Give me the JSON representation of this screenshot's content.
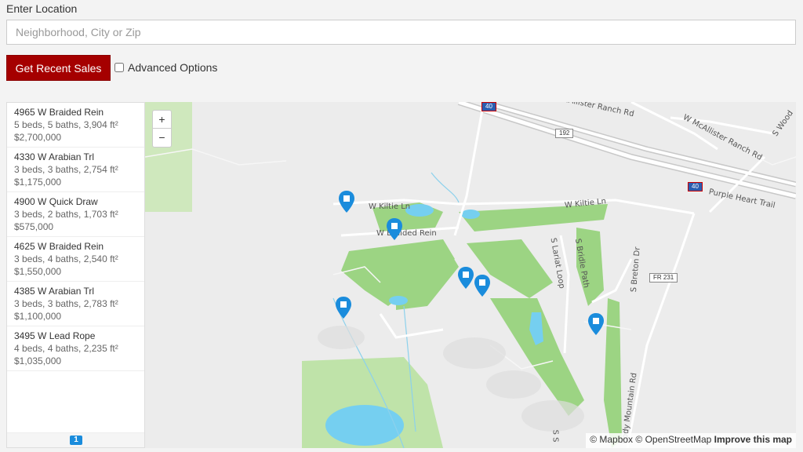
{
  "search": {
    "label": "Enter Location",
    "placeholder": "Neighborhood, City or Zip",
    "button_label": "Get Recent Sales",
    "advanced_label": "Advanced Options"
  },
  "listings": [
    {
      "address": "4965 W Braided Rein",
      "details": "5 beds, 5 baths, 3,904 ft²",
      "price": "$2,700,000"
    },
    {
      "address": "4330 W Arabian Trl",
      "details": "3 beds, 3 baths, 2,754 ft²",
      "price": "$1,175,000"
    },
    {
      "address": "4900 W Quick Draw",
      "details": "3 beds, 2 baths, 1,703 ft²",
      "price": "$575,000"
    },
    {
      "address": "4625 W Braided Rein",
      "details": "3 beds, 4 baths, 2,540 ft²",
      "price": "$1,550,000"
    },
    {
      "address": "4385 W Arabian Trl",
      "details": "3 beds, 3 baths, 2,783 ft²",
      "price": "$1,100,000"
    },
    {
      "address": "3495 W Lead Rope",
      "details": "4 beds, 4 baths, 2,235 ft²",
      "price": "$1,035,000"
    }
  ],
  "pagination": {
    "current_page": "1"
  },
  "map": {
    "zoom_in": "+",
    "zoom_out": "−",
    "labels": {
      "mcallister_ranch": "McAllister Ranch Rd",
      "w_mcallister_ranch": "W McAllister Ranch Rd",
      "s_wood": "S Wood",
      "w_kiltie_ln_1": "W Kiltie Ln",
      "w_kiltie_ln_2": "W Kiltie Ln",
      "w_braided_rein": "W Braided Rein",
      "purple_heart_trail": "Purple Heart Trail",
      "s_lariat_loop": "S Lariat Loop",
      "s_bridle_path": "S Bridle Path",
      "s_breton_dr": "S Breton Dr",
      "body_mountain_rd": "Body Mountain Rd",
      "s_s": "S S"
    },
    "shields": {
      "fr_192": "192",
      "fr_231": "FR 231",
      "i40": "40",
      "i40_top": "40"
    },
    "attribution": {
      "mapbox": "© Mapbox",
      "osm": "© OpenStreetMap",
      "improve": "Improve this map"
    },
    "colors": {
      "pin": "#1a8cdc",
      "park": "#bfe3a9",
      "golf": "#9cd483",
      "water": "#75cff0",
      "road": "#ffffff",
      "land": "#ececec"
    }
  }
}
